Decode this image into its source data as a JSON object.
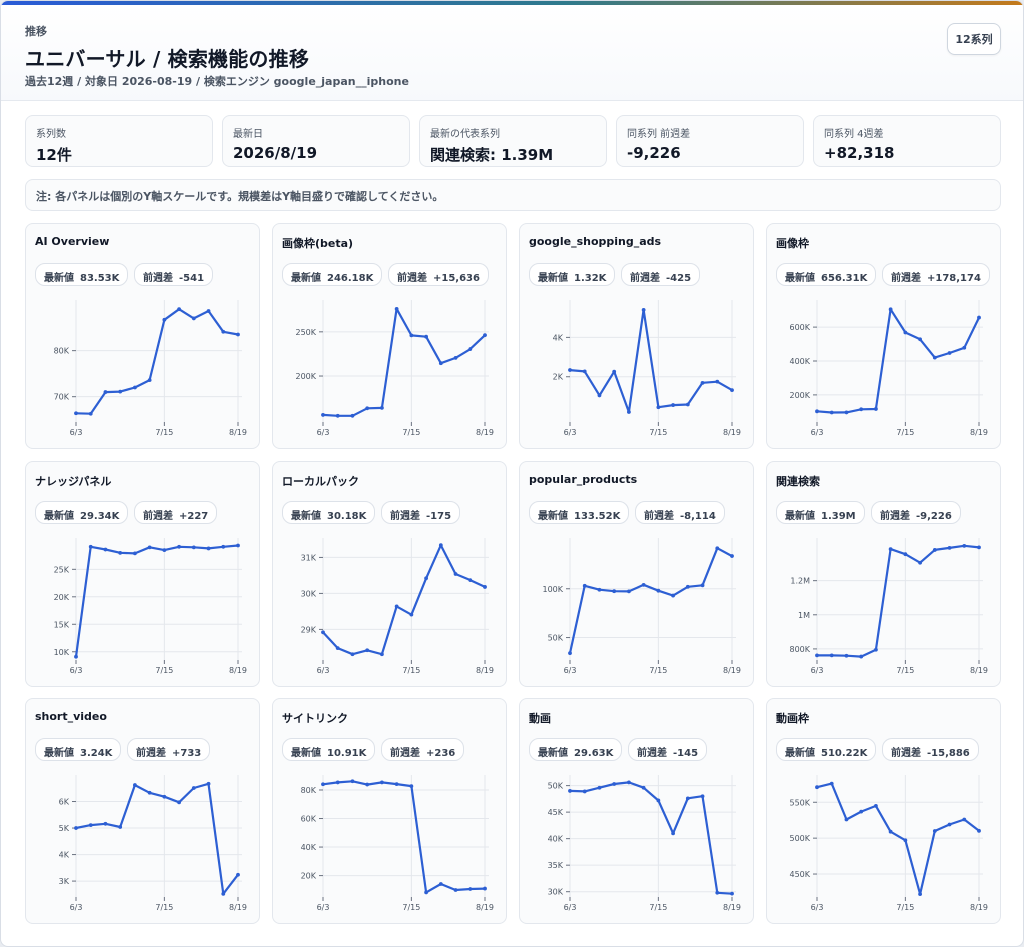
{
  "header": {
    "eyebrow": "推移",
    "title": "ユニバーサル / 検索機能の推移",
    "subtitle": "過去12週 / 対象日 2026-08-19 / 検索エンジン google_japan__iphone",
    "series_button": "12系列"
  },
  "stats": [
    {
      "label": "系列数",
      "value": "12件"
    },
    {
      "label": "最新日",
      "value": "2026/8/19"
    },
    {
      "label": "最新の代表系列",
      "value": "関連検索: 1.39M"
    },
    {
      "label": "同系列 前週差",
      "value": "-9,226"
    },
    {
      "label": "同系列 4週差",
      "value": "+82,318"
    }
  ],
  "note": "注: 各パネルは個別のY軸スケールです。規模差はY軸目盛りで確認してください。",
  "pill_labels": {
    "latest": "最新値",
    "wow": "前週差"
  },
  "chart_data": [
    {
      "type": "line",
      "title": "AI Overview",
      "latest": "83.53K",
      "wow": "-541",
      "x": [
        "6/3",
        "6/10",
        "6/17",
        "6/24",
        "7/1",
        "7/8",
        "7/15",
        "7/22",
        "7/29",
        "8/5",
        "8/12",
        "8/19"
      ],
      "xticks": [
        "6/3",
        "7/15",
        "8/19"
      ],
      "values": [
        66400,
        66300,
        71000,
        71100,
        72000,
        73600,
        86700,
        89000,
        87000,
        88600,
        84100,
        83500
      ],
      "ylim": [
        64500,
        91000
      ],
      "yticks": [
        70000,
        80000
      ],
      "yticklabels": [
        "70K",
        "80K"
      ],
      "line_color": "#2d5fd3"
    },
    {
      "type": "line",
      "title": "画像枠(beta)",
      "latest": "246.18K",
      "wow": "+15,636",
      "x": [
        "6/3",
        "6/10",
        "6/17",
        "6/24",
        "7/1",
        "7/8",
        "7/15",
        "7/22",
        "7/29",
        "8/5",
        "8/12",
        "8/19"
      ],
      "xticks": [
        "6/3",
        "7/15",
        "8/19"
      ],
      "values": [
        156000,
        155000,
        155000,
        163500,
        164000,
        276000,
        246000,
        244500,
        214500,
        220500,
        230500,
        246200
      ],
      "ylim": [
        148000,
        286000
      ],
      "yticks": [
        200000,
        250000
      ],
      "yticklabels": [
        "200K",
        "250K"
      ],
      "line_color": "#2d5fd3"
    },
    {
      "type": "line",
      "title": "google_shopping_ads",
      "latest": "1.32K",
      "wow": "-425",
      "x": [
        "6/3",
        "6/10",
        "6/17",
        "6/24",
        "7/1",
        "7/8",
        "7/15",
        "7/22",
        "7/29",
        "8/5",
        "8/12",
        "8/19"
      ],
      "xticks": [
        "6/3",
        "7/15",
        "8/19"
      ],
      "values": [
        2340,
        2270,
        1050,
        2260,
        210,
        5400,
        450,
        560,
        590,
        1690,
        1750,
        1320
      ],
      "ylim": [
        -300,
        5900
      ],
      "yticks": [
        2000,
        4000
      ],
      "yticklabels": [
        "2K",
        "4K"
      ],
      "line_color": "#2d5fd3"
    },
    {
      "type": "line",
      "title": "画像枠",
      "latest": "656.31K",
      "wow": "+178,174",
      "x": [
        "6/3",
        "6/10",
        "6/17",
        "6/24",
        "7/1",
        "7/8",
        "7/15",
        "7/22",
        "7/29",
        "8/5",
        "8/12",
        "8/19"
      ],
      "xticks": [
        "6/3",
        "7/15",
        "8/19"
      ],
      "values": [
        103000,
        96000,
        96500,
        115000,
        117000,
        705000,
        568000,
        528000,
        420000,
        447000,
        478000,
        656300
      ],
      "ylim": [
        40000,
        760000
      ],
      "yticks": [
        200000,
        400000,
        600000
      ],
      "yticklabels": [
        "200K",
        "400K",
        "600K"
      ],
      "line_color": "#2d5fd3"
    },
    {
      "type": "line",
      "title": "ナレッジパネル",
      "latest": "29.34K",
      "wow": "+227",
      "x": [
        "6/3",
        "6/10",
        "6/17",
        "6/24",
        "7/1",
        "7/8",
        "7/15",
        "7/22",
        "7/29",
        "8/5",
        "8/12",
        "8/19"
      ],
      "xticks": [
        "6/3",
        "7/15",
        "8/19"
      ],
      "values": [
        9100,
        29100,
        28600,
        28000,
        27900,
        29000,
        28500,
        29100,
        29000,
        28800,
        29100,
        29340
      ],
      "ylim": [
        8500,
        30700
      ],
      "yticks": [
        10000,
        15000,
        20000,
        25000
      ],
      "yticklabels": [
        "10K",
        "15K",
        "20K",
        "25K"
      ],
      "line_color": "#2d5fd3"
    },
    {
      "type": "line",
      "title": "ローカルパック",
      "latest": "30.18K",
      "wow": "-175",
      "x": [
        "6/3",
        "6/10",
        "6/17",
        "6/24",
        "7/1",
        "7/8",
        "7/15",
        "7/22",
        "7/29",
        "8/5",
        "8/12",
        "8/19"
      ],
      "xticks": [
        "6/3",
        "7/15",
        "8/19"
      ],
      "values": [
        28920,
        28480,
        28310,
        28420,
        28310,
        29640,
        29410,
        30420,
        31340,
        30540,
        30370,
        30180
      ],
      "ylim": [
        28150,
        31540
      ],
      "yticks": [
        29000,
        30000,
        31000
      ],
      "yticklabels": [
        "29K",
        "30K",
        "31K"
      ],
      "line_color": "#2d5fd3"
    },
    {
      "type": "line",
      "title": "popular_products",
      "latest": "133.52K",
      "wow": "-8,114",
      "x": [
        "6/3",
        "6/10",
        "6/17",
        "6/24",
        "7/1",
        "7/8",
        "7/15",
        "7/22",
        "7/29",
        "8/5",
        "8/12",
        "8/19"
      ],
      "xticks": [
        "6/3",
        "7/15",
        "8/19"
      ],
      "values": [
        34000,
        103000,
        99000,
        97500,
        97300,
        104000,
        98000,
        93000,
        102000,
        103500,
        141500,
        133500
      ],
      "ylim": [
        27000,
        152000
      ],
      "yticks": [
        50000,
        100000
      ],
      "yticklabels": [
        "50K",
        "100K"
      ],
      "line_color": "#2d5fd3"
    },
    {
      "type": "line",
      "title": "関連検索",
      "latest": "1.39M",
      "wow": "-9,226",
      "x": [
        "6/3",
        "6/10",
        "6/17",
        "6/24",
        "7/1",
        "7/8",
        "7/15",
        "7/22",
        "7/29",
        "8/5",
        "8/12",
        "8/19"
      ],
      "xticks": [
        "6/3",
        "7/15",
        "8/19"
      ],
      "values": [
        762000,
        762000,
        760000,
        755000,
        795000,
        1385000,
        1355000,
        1305000,
        1380000,
        1392000,
        1404000,
        1394900
      ],
      "ylim": [
        735000,
        1450000
      ],
      "yticks": [
        800000,
        1000000,
        1200000
      ],
      "yticklabels": [
        "800K",
        "1M",
        "1.2M"
      ],
      "line_color": "#2d5fd3"
    },
    {
      "type": "line",
      "title": "short_video",
      "latest": "3.24K",
      "wow": "+733",
      "x": [
        "6/3",
        "6/10",
        "6/17",
        "6/24",
        "7/1",
        "7/8",
        "7/15",
        "7/22",
        "7/29",
        "8/5",
        "8/12",
        "8/19"
      ],
      "xticks": [
        "6/3",
        "7/15",
        "8/19"
      ],
      "values": [
        5000,
        5110,
        5160,
        5040,
        6620,
        6330,
        6180,
        5970,
        6510,
        6670,
        2520,
        3240
      ],
      "ylim": [
        2400,
        7000
      ],
      "yticks": [
        3000,
        4000,
        5000,
        6000
      ],
      "yticklabels": [
        "3K",
        "4K",
        "5K",
        "6K"
      ],
      "line_color": "#2d5fd3"
    },
    {
      "type": "line",
      "title": "サイトリンク",
      "latest": "10.91K",
      "wow": "+236",
      "x": [
        "6/3",
        "6/10",
        "6/17",
        "6/24",
        "7/1",
        "7/8",
        "7/15",
        "7/22",
        "7/29",
        "8/5",
        "8/12",
        "8/19"
      ],
      "xticks": [
        "6/3",
        "7/15",
        "8/19"
      ],
      "values": [
        84000,
        85300,
        86100,
        83800,
        85300,
        84100,
        82700,
        8200,
        14100,
        9900,
        10600,
        10900
      ],
      "ylim": [
        5000,
        90500
      ],
      "yticks": [
        20000,
        40000,
        60000,
        80000
      ],
      "yticklabels": [
        "20K",
        "40K",
        "60K",
        "80K"
      ],
      "line_color": "#2d5fd3"
    },
    {
      "type": "line",
      "title": "動画",
      "latest": "29.63K",
      "wow": "-145",
      "x": [
        "6/3",
        "6/10",
        "6/17",
        "6/24",
        "7/1",
        "7/8",
        "7/15",
        "7/22",
        "7/29",
        "8/5",
        "8/12",
        "8/19"
      ],
      "xticks": [
        "6/3",
        "7/15",
        "8/19"
      ],
      "values": [
        49000,
        48900,
        49600,
        50300,
        50600,
        49600,
        47200,
        41000,
        47600,
        48000,
        29800,
        29630
      ],
      "ylim": [
        29000,
        52000
      ],
      "yticks": [
        30000,
        35000,
        40000,
        45000,
        50000
      ],
      "yticklabels": [
        "30K",
        "35K",
        "40K",
        "45K",
        "50K"
      ],
      "line_color": "#2d5fd3"
    },
    {
      "type": "line",
      "title": "動画枠",
      "latest": "510.22K",
      "wow": "-15,886",
      "x": [
        "6/3",
        "6/10",
        "6/17",
        "6/24",
        "7/1",
        "7/8",
        "7/15",
        "7/22",
        "7/29",
        "8/5",
        "8/12",
        "8/19"
      ],
      "xticks": [
        "6/3",
        "7/15",
        "8/19"
      ],
      "values": [
        571000,
        576000,
        526000,
        537000,
        545000,
        509000,
        497000,
        422000,
        510000,
        519000,
        526000,
        510200
      ],
      "ylim": [
        418000,
        588000
      ],
      "yticks": [
        450000,
        500000,
        550000
      ],
      "yticklabels": [
        "450K",
        "500K",
        "550K"
      ],
      "line_color": "#2d5fd3"
    }
  ]
}
